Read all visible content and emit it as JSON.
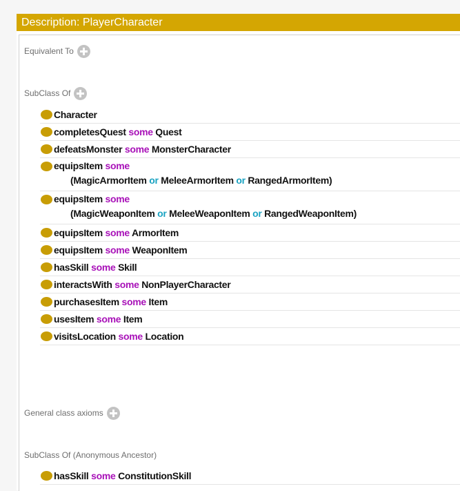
{
  "header": {
    "title": "Description: PlayerCharacter"
  },
  "sections": {
    "equivalent_to": "Equivalent To",
    "subclass_of": "SubClass Of",
    "general_class_axioms": "General class axioms",
    "subclass_of_anonymous": "SubClass Of (Anonymous Ancestor)"
  },
  "subclass_axioms": [
    {
      "parts": [
        {
          "text": "Character",
          "role": "term"
        }
      ]
    },
    {
      "parts": [
        {
          "text": "completesQuest",
          "role": "term"
        },
        {
          "text": "some",
          "role": "keyword"
        },
        {
          "text": "Quest",
          "role": "term"
        }
      ]
    },
    {
      "parts": [
        {
          "text": "defeatsMonster",
          "role": "term"
        },
        {
          "text": "some",
          "role": "keyword"
        },
        {
          "text": "MonsterCharacter",
          "role": "term"
        }
      ]
    },
    {
      "parts": [
        {
          "text": "equipsItem",
          "role": "term"
        },
        {
          "text": "some",
          "role": "keyword"
        }
      ],
      "continuation": [
        {
          "text": "(MagicArmorItem",
          "role": "term"
        },
        {
          "text": "or",
          "role": "operator"
        },
        {
          "text": "MeleeArmorItem",
          "role": "term"
        },
        {
          "text": "or",
          "role": "operator"
        },
        {
          "text": "RangedArmorItem)",
          "role": "term"
        }
      ]
    },
    {
      "parts": [
        {
          "text": "equipsItem",
          "role": "term"
        },
        {
          "text": "some",
          "role": "keyword"
        }
      ],
      "continuation": [
        {
          "text": "(MagicWeaponItem",
          "role": "term"
        },
        {
          "text": "or",
          "role": "operator"
        },
        {
          "text": "MeleeWeaponItem",
          "role": "term"
        },
        {
          "text": "or",
          "role": "operator"
        },
        {
          "text": "RangedWeaponItem)",
          "role": "term"
        }
      ]
    },
    {
      "parts": [
        {
          "text": "equipsItem",
          "role": "term"
        },
        {
          "text": "some",
          "role": "keyword"
        },
        {
          "text": "ArmorItem",
          "role": "term"
        }
      ]
    },
    {
      "parts": [
        {
          "text": "equipsItem",
          "role": "term"
        },
        {
          "text": "some",
          "role": "keyword"
        },
        {
          "text": "WeaponItem",
          "role": "term"
        }
      ]
    },
    {
      "parts": [
        {
          "text": "hasSkill",
          "role": "term"
        },
        {
          "text": "some",
          "role": "keyword"
        },
        {
          "text": "Skill",
          "role": "term"
        }
      ]
    },
    {
      "parts": [
        {
          "text": "interactsWith",
          "role": "term"
        },
        {
          "text": "some",
          "role": "keyword"
        },
        {
          "text": "NonPlayerCharacter",
          "role": "term"
        }
      ]
    },
    {
      "parts": [
        {
          "text": "purchasesItem",
          "role": "term"
        },
        {
          "text": "some",
          "role": "keyword"
        },
        {
          "text": "Item",
          "role": "term"
        }
      ]
    },
    {
      "parts": [
        {
          "text": "usesItem",
          "role": "term"
        },
        {
          "text": "some",
          "role": "keyword"
        },
        {
          "text": "Item",
          "role": "term"
        }
      ]
    },
    {
      "parts": [
        {
          "text": "visitsLocation",
          "role": "term"
        },
        {
          "text": "some",
          "role": "keyword"
        },
        {
          "text": "Location",
          "role": "term"
        }
      ]
    }
  ],
  "ancestor_axioms": [
    {
      "parts": [
        {
          "text": "hasSkill",
          "role": "term"
        },
        {
          "text": "some",
          "role": "keyword"
        },
        {
          "text": "ConstitutionSkill",
          "role": "term"
        }
      ]
    }
  ],
  "colors": {
    "header": "#d4a602",
    "bullet": "#c89d05",
    "keyword": "#a811b8",
    "operator": "#1aa3c2"
  }
}
